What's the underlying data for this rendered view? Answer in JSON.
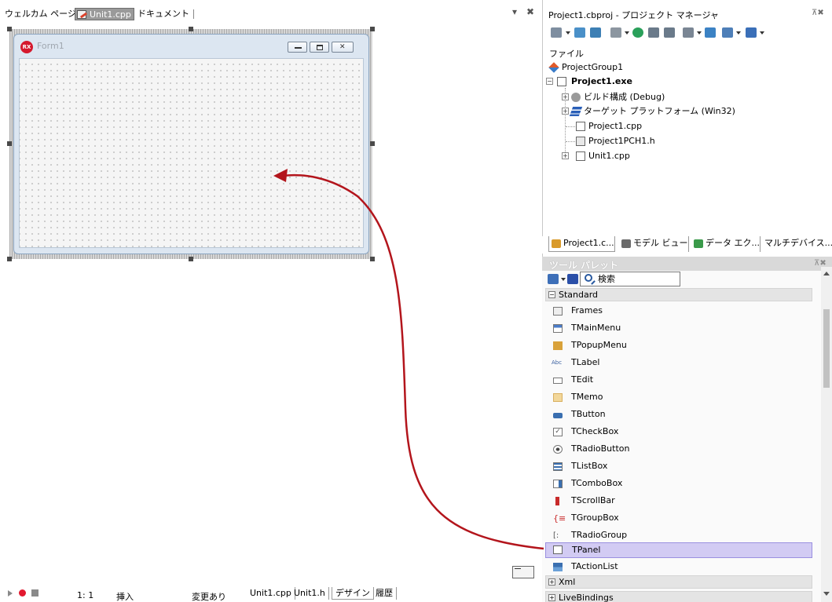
{
  "editor": {
    "tabs": [
      "ウェルカム ページ",
      "Unit1.cpp",
      "ドキュメント"
    ],
    "pane_controls": {
      "pin": "▾",
      "close": "✖"
    }
  },
  "form": {
    "title": "Form1",
    "icon_text": "RX"
  },
  "status": {
    "position": "1:  1",
    "mode": "挿入",
    "modified": "変更あり",
    "tabs": [
      "Unit1.cpp",
      "Unit1.h",
      "デザイン",
      "履歴"
    ],
    "active_tab": "デザイン"
  },
  "project_manager": {
    "title": "Project1.cbproj - プロジェクト マネージャ",
    "pin": "⊼✖",
    "file_label": "ファイル",
    "tree": {
      "group": "ProjectGroup1",
      "project": "Project1.exe",
      "build": "ビルド構成 (Debug)",
      "platform": "ターゲット プラットフォーム (Win32)",
      "file_cpp": "Project1.cpp",
      "file_pch": "Project1PCH1.h",
      "unit": "Unit1.cpp"
    },
    "bottom_tabs": [
      "Project1.c...",
      "モデル ビュー",
      "データ エク...",
      "マルチデバイス..."
    ]
  },
  "tool_palette": {
    "title": "ツール パレット",
    "pin": "⊼✖",
    "search_placeholder": "検索",
    "categories": [
      "Standard",
      "Xml",
      "LiveBindings"
    ],
    "components": [
      "Frames",
      "TMainMenu",
      "TPopupMenu",
      "TLabel",
      "TEdit",
      "TMemo",
      "TButton",
      "TCheckBox",
      "TRadioButton",
      "TListBox",
      "TComboBox",
      "TScrollBar",
      "TGroupBox",
      "TRadioGroup",
      "TPanel",
      "TActionList"
    ],
    "selected": "TPanel",
    "label_icon_text": "Abc"
  },
  "colors": {
    "arrow": "#b3151c",
    "selection": "#d2cbf3",
    "form_frame": "#dce6f1"
  }
}
